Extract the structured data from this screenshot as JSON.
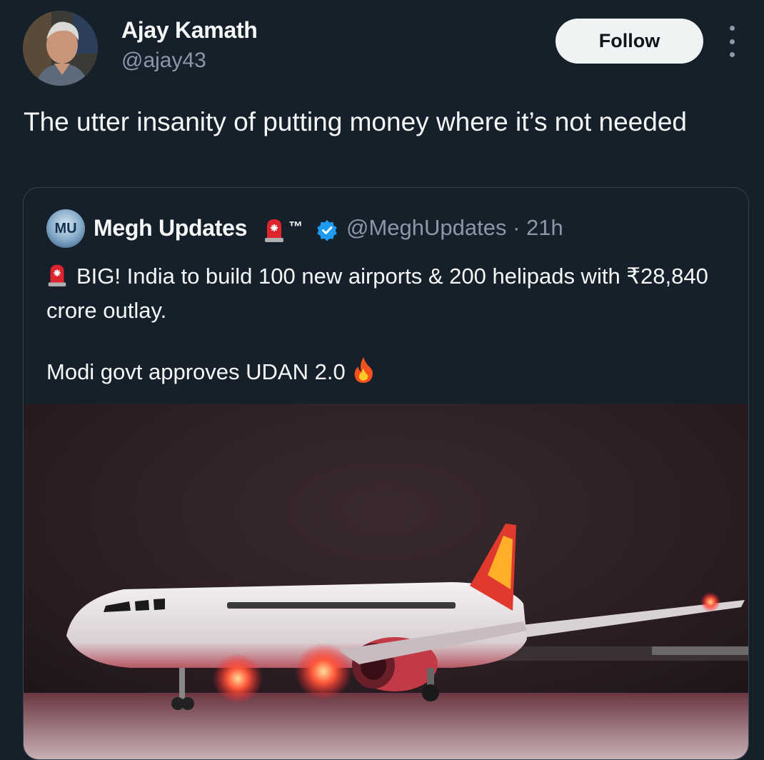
{
  "author": {
    "name": "Ajay Kamath",
    "handle": "@ajay43"
  },
  "follow_label": "Follow",
  "tweet_text": "The utter insanity of putting money where it’s not needed",
  "quote": {
    "avatar_text": "MU",
    "name": "Megh Updates",
    "tm": "™",
    "handle": "@MeghUpdates",
    "time": "· 21h",
    "line1": "BIG! India to build 100 new airports & 200 helipads with ₹28,840 crore outlay.",
    "line2": "Modi govt approves UDAN 2.0",
    "icons": [
      "siren-icon",
      "verified-badge-icon",
      "fire-icon"
    ]
  },
  "colors": {
    "background": "#15202b",
    "primary_text": "#f7f9f9",
    "secondary_text": "#8b98a5",
    "border": "#38444d",
    "verified": "#1d9bf0"
  }
}
